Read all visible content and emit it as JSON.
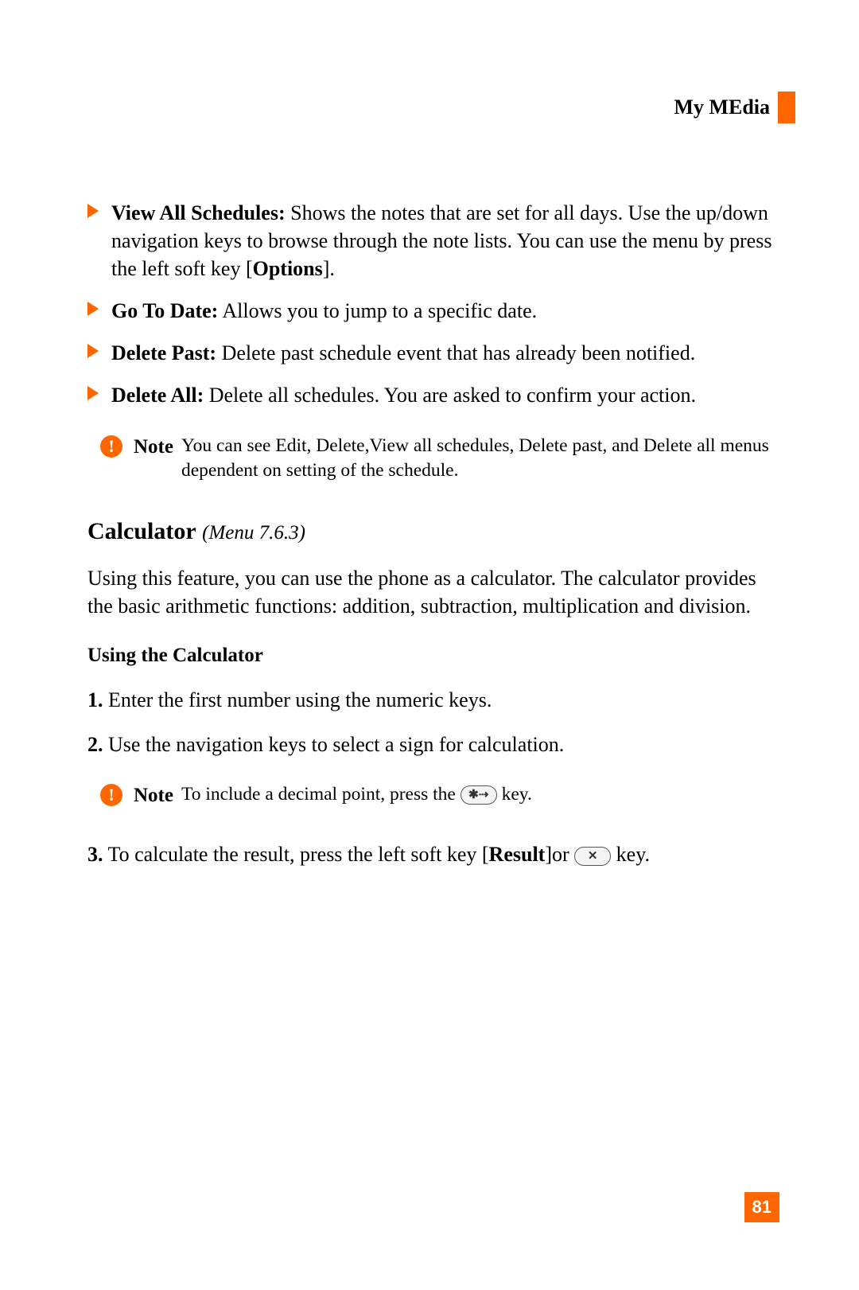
{
  "header": {
    "title": "My MEdia"
  },
  "bullets": [
    {
      "title": "View All Schedules:",
      "text": " Shows the notes that are set for all days. Use the up/down navigation keys to browse through the note lists. You can use the menu by press the left soft key [",
      "bold_inline": "Options",
      "text_after": "]."
    },
    {
      "title": "Go To Date:",
      "text": " Allows you to jump to a specific date."
    },
    {
      "title": "Delete Past:",
      "text": " Delete past schedule event that has already been notified."
    },
    {
      "title": "Delete All:",
      "text": " Delete all schedules. You are asked to confirm your action."
    }
  ],
  "note1": {
    "label": "Note",
    "text": "You can see Edit, Delete,View all schedules, Delete past, and Delete all menus dependent on setting of the schedule."
  },
  "section": {
    "heading": "Calculator",
    "menu_ref": "(Menu 7.6.3)",
    "paragraph": "Using this feature, you can use the phone as a calculator. The calculator provides the basic arithmetic functions: addition, subtraction, multiplication and division.",
    "sub_heading": "Using the Calculator"
  },
  "steps": {
    "s1_num": "1.",
    "s1_text": " Enter the first number using the numeric keys.",
    "s2_num": "2.",
    "s2_text": " Use the navigation keys to select a sign for calculation.",
    "s3_num": "3.",
    "s3_pre": " To calculate the result, press the left soft key [",
    "s3_bold": "Result",
    "s3_mid": "]or ",
    "s3_post": " key."
  },
  "note2": {
    "label": "Note",
    "pre": "To include a decimal point, press the ",
    "post": " key."
  },
  "key_star": "✱⇢",
  "key_x": "✕",
  "page_number": "81"
}
